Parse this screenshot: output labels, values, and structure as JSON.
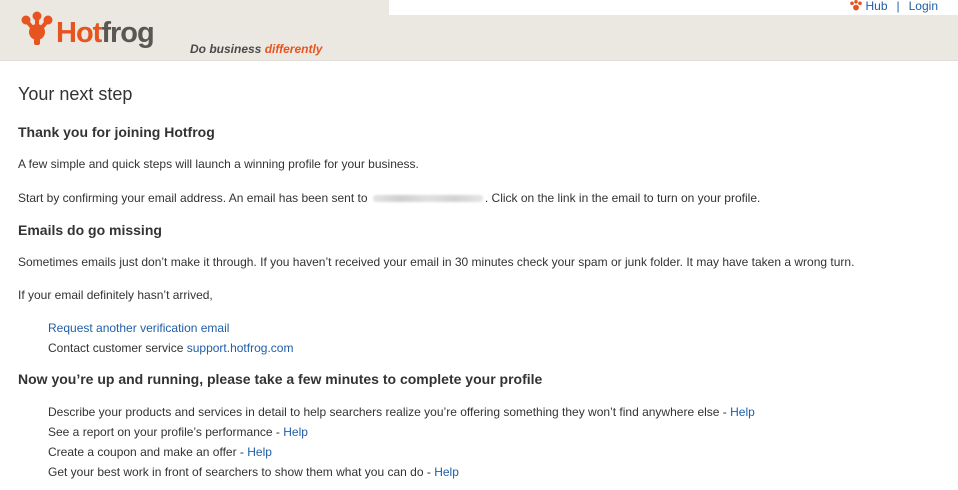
{
  "header": {
    "logo_hot": "Hot",
    "logo_frog": "frog",
    "tagline_plain": "Do business ",
    "tagline_accent": "differently",
    "links": {
      "hub": "Hub",
      "separator": "|",
      "login": "Login"
    }
  },
  "colors": {
    "brand_orange": "#e8541f",
    "link_blue": "#1f5ea8",
    "header_bg": "#ebe8e1"
  },
  "main": {
    "page_title": "Your next step",
    "welcome": {
      "heading": "Thank you for joining Hotfrog",
      "intro": "A few simple and quick steps will launch a winning profile for your business.",
      "confirm_before": "Start by confirming your email address. An email has been sent to",
      "confirm_after": ". Click on the link in the email to turn on your profile."
    },
    "missing": {
      "heading": "Emails do go missing",
      "text": "Sometimes emails just don’t make it through. If you haven’t received your email in 30 minutes check your spam or junk folder. It may have taken a wrong turn.",
      "not_arrived": "If your email definitely hasn’t arrived,",
      "resend_link": "Request another verification email",
      "contact_text": "Contact customer service ",
      "support_link": "support.hotfrog.com"
    },
    "profile": {
      "heading": "Now you’re up and running, please take a few minutes to complete your profile",
      "items": [
        {
          "text": "Describe your products and services in detail to help searchers realize you’re offering something they won’t find anywhere else - ",
          "link": "Help"
        },
        {
          "text": "See a report on your profile’s performance - ",
          "link": "Help"
        },
        {
          "text": "Create a coupon and make an offer - ",
          "link": "Help"
        },
        {
          "text": "Get your best work in front of searchers to show them what you can do - ",
          "link": "Help"
        }
      ]
    }
  }
}
